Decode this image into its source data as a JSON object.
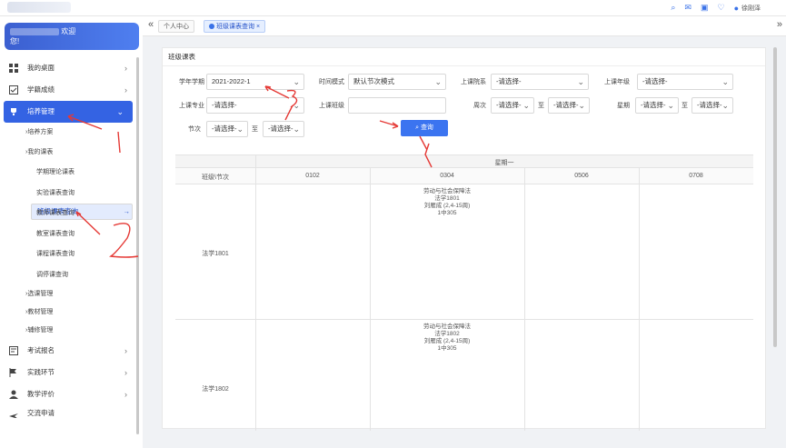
{
  "header": {
    "user_name": "徐刚泽"
  },
  "sidebar": {
    "welcome_text": "欢迎",
    "welcome_suffix": "您!",
    "items": [
      {
        "label": "我的桌面",
        "icon": "desktop-icon"
      },
      {
        "label": "学籍成绩",
        "icon": "checklist-icon"
      },
      {
        "label": "培养管理",
        "icon": "trophy-icon"
      }
    ],
    "peiyang_children": [
      {
        "label": "培养方案",
        "prefix": "›"
      },
      {
        "label": "我的课表",
        "prefix": "›"
      }
    ],
    "kebiao_children": [
      {
        "label": "学期理论课表"
      },
      {
        "label": "实验课表查询"
      },
      {
        "label": "班级课表查询"
      },
      {
        "label": "教师课表查询"
      },
      {
        "label": "教室课表查询"
      },
      {
        "label": "课程课表查询"
      },
      {
        "label": "调停课查询"
      }
    ],
    "more_groups": [
      {
        "label": "选课管理"
      },
      {
        "label": "教材管理"
      },
      {
        "label": "辅修管理"
      }
    ],
    "bottom_items": [
      {
        "label": "考试报名",
        "icon": "exam-icon"
      },
      {
        "label": "实践环节",
        "icon": "flag-icon"
      },
      {
        "label": "教学评价",
        "icon": "person-icon"
      },
      {
        "label": "交流申请",
        "icon": "plane-icon"
      }
    ]
  },
  "tabs": [
    {
      "label": "个人中心"
    },
    {
      "label": "班级课表查询"
    }
  ],
  "panel": {
    "title": "班级课表",
    "filters": {
      "term_label": "学年学期",
      "term_value": "2021-2022-1",
      "time_mode_label": "时间模式",
      "time_mode_value": "默认节次模式",
      "college_label": "上课院系",
      "college_value": "-请选择-",
      "grade_label": "上课年级",
      "grade_value": "-请选择-",
      "major_label": "上课专业",
      "major_value": "-请选择-",
      "class_label": "上课班级",
      "class_value": "",
      "week_label": "周次",
      "week_from": "-请选择-",
      "week_to": "-请选择-",
      "weekday_label": "星期",
      "weekday_from": "-请选择-",
      "weekday_to": "-请选择-",
      "section_label": "节次",
      "section_from": "-请选择-",
      "section_to": "-请选择-",
      "to_text": "至",
      "query_label": "查询"
    }
  },
  "grid": {
    "day_header": "星期一",
    "corner": "班级\\节次",
    "columns": [
      "0102",
      "0304",
      "0506",
      "0708"
    ],
    "rows": [
      {
        "class": "法学1801",
        "course": [
          "劳动与社会保障法",
          "法学1801",
          "刘雁成 (2,4-15周)",
          "1中305"
        ]
      },
      {
        "class": "法学1802",
        "course": [
          "劳动与社会保障法",
          "法学1802",
          "刘雁成 (2,4-15周)",
          "1中305"
        ]
      }
    ]
  },
  "annotations": {
    "mark1": "1",
    "mark2": "2",
    "mark3": "3",
    "mark4": "4"
  }
}
